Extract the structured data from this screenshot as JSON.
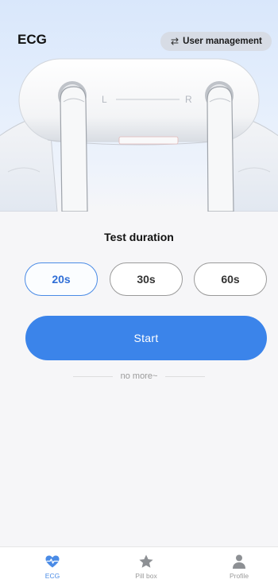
{
  "header": {
    "title": "ECG",
    "user_management_label": "User management",
    "device_labels": {
      "left": "L",
      "right": "R"
    }
  },
  "duration": {
    "title": "Test duration",
    "options": [
      "20s",
      "30s",
      "60s"
    ],
    "selected": "20s"
  },
  "start_label": "Start",
  "footer_note": "no more~",
  "tabbar": {
    "items": [
      {
        "label": "ECG",
        "icon": "heart-pulse-icon",
        "active": true
      },
      {
        "label": "Pill box",
        "icon": "star-icon",
        "active": false
      },
      {
        "label": "Profile",
        "icon": "person-icon",
        "active": false
      }
    ]
  },
  "colors": {
    "accent": "#3b84ea",
    "selected_border": "#4a8be6",
    "hero_top": "#d9e7fb",
    "page_bg": "#f6f6f8",
    "inactive": "#9a9a9a"
  }
}
